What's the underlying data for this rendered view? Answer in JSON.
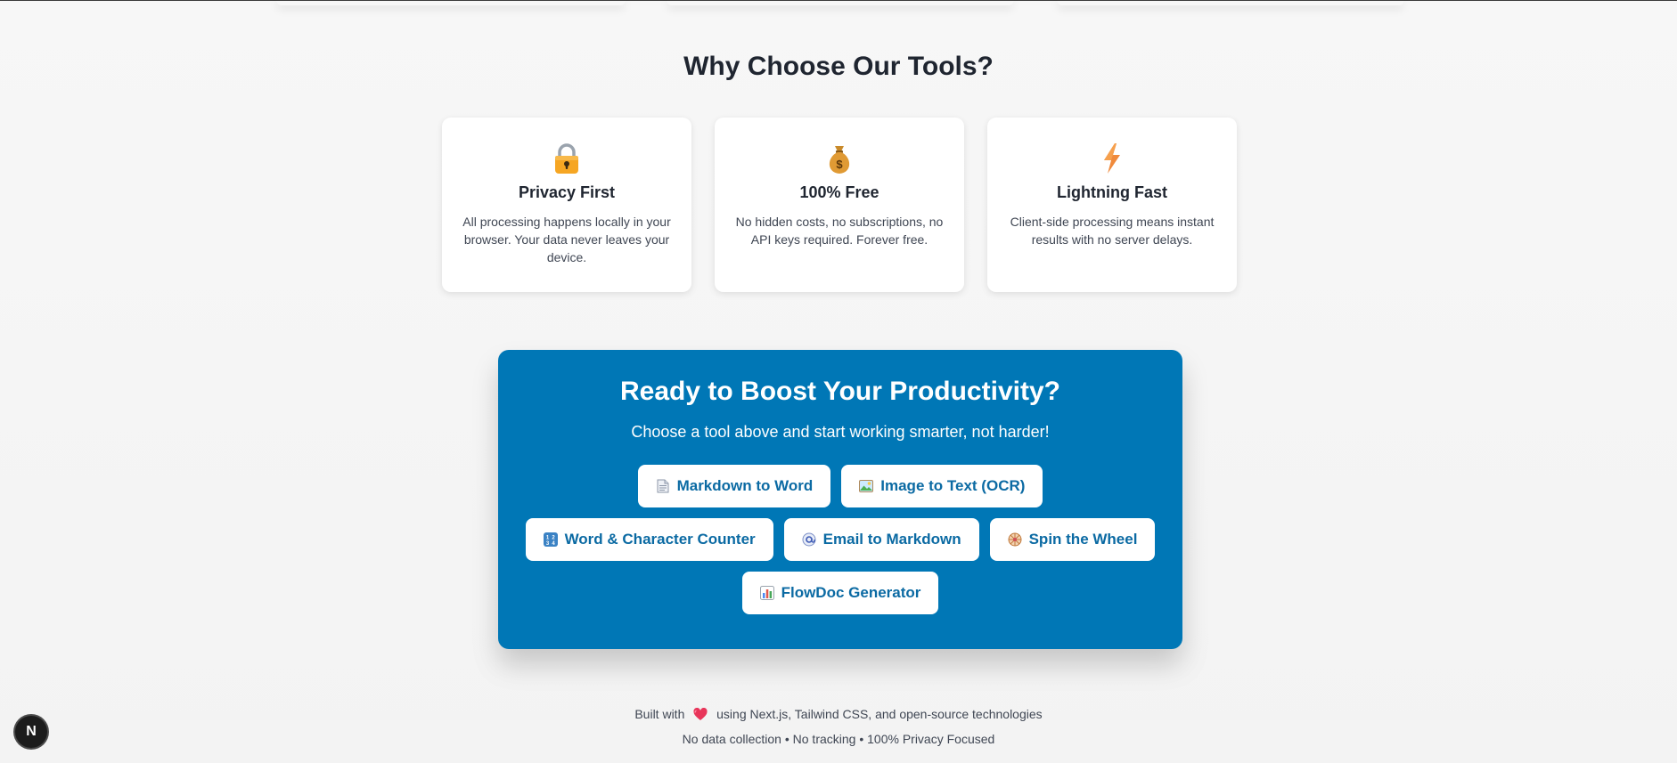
{
  "section": {
    "title": "Why Choose Our Tools?"
  },
  "features": [
    {
      "icon": "lock-icon",
      "title": "Privacy First",
      "description": "All processing happens locally in your browser. Your data never leaves your device."
    },
    {
      "icon": "money-bag-icon",
      "title": "100% Free",
      "description": "No hidden costs, no subscriptions, no API keys required. Forever free."
    },
    {
      "icon": "lightning-icon",
      "title": "Lightning Fast",
      "description": "Client-side processing means instant results with no server delays."
    }
  ],
  "cta": {
    "title": "Ready to Boost Your Productivity?",
    "subtitle": "Choose a tool above and start working smarter, not harder!",
    "buttons": [
      {
        "label": "Markdown to Word",
        "icon": "document-icon"
      },
      {
        "label": "Image to Text (OCR)",
        "icon": "picture-icon"
      },
      {
        "label": "Word & Character Counter",
        "icon": "numbers-icon"
      },
      {
        "label": "Email to Markdown",
        "icon": "email-icon"
      },
      {
        "label": "Spin the Wheel",
        "icon": "wheel-icon"
      },
      {
        "label": "FlowDoc Generator",
        "icon": "chart-icon"
      }
    ],
    "background": "#0077b6",
    "button_text_color": "#0b6aa3"
  },
  "footer": {
    "built_prefix": "Built with",
    "built_suffix": "using Next.js, Tailwind CSS, and open-source technologies",
    "privacy_line": "No data collection • No tracking • 100% Privacy Focused"
  },
  "dev_badge": {
    "letter": "N",
    "icon": "nextjs-icon"
  }
}
